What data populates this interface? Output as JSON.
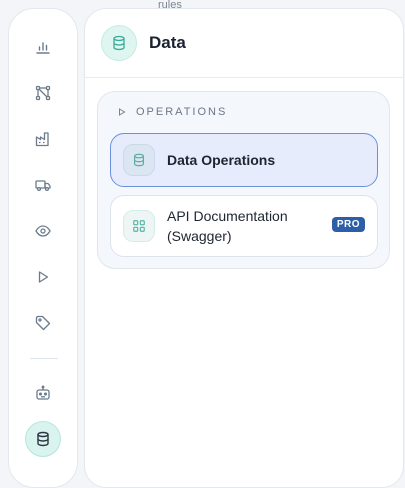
{
  "background_text": "rules",
  "rail": {
    "items": [
      {
        "icon": "bar-chart-icon"
      },
      {
        "icon": "workflow-nodes-icon"
      },
      {
        "icon": "factory-icon"
      },
      {
        "icon": "truck-icon"
      },
      {
        "icon": "eye-icon"
      },
      {
        "icon": "play-icon"
      },
      {
        "icon": "tag-icon"
      }
    ],
    "bottom_items": [
      {
        "icon": "robot-icon"
      },
      {
        "icon": "database-icon",
        "active": true
      }
    ]
  },
  "panel": {
    "title": "Data",
    "icon": "database-icon",
    "section": {
      "label": "OPERATIONS",
      "items": [
        {
          "label": "Data Operations",
          "icon": "database-icon",
          "active": true
        },
        {
          "label": "API Documentation (Swagger)",
          "icon": "grid-icon",
          "badge": "PRO"
        }
      ]
    }
  },
  "colors": {
    "accent_teal": "#3aa99a",
    "active_border": "#6c8fe0",
    "pro_badge": "#2d5fa8"
  }
}
